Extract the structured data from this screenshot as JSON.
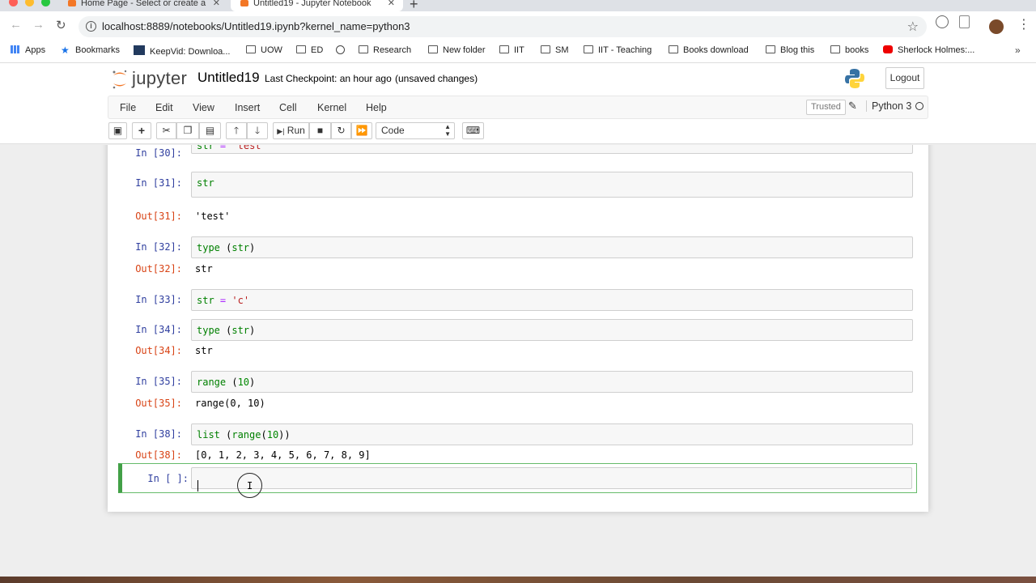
{
  "browser": {
    "tabs": [
      {
        "title": "Home Page - Select or create a",
        "active": false
      },
      {
        "title": "Untitled19 - Jupyter Notebook",
        "active": true
      }
    ],
    "url": "localhost:8889/notebooks/Untitled19.ipynb?kernel_name=python3",
    "bookmarks": [
      {
        "label": "Apps",
        "icon": "apps-grid-icon"
      },
      {
        "label": "Bookmarks",
        "icon": "star-icon"
      },
      {
        "label": "KeepVid: Downloa...",
        "icon": "keepvid-icon"
      },
      {
        "label": "UOW",
        "icon": "folder-icon"
      },
      {
        "label": "ED",
        "icon": "folder-icon"
      },
      {
        "label": "Research",
        "icon": "folder-icon"
      },
      {
        "label": "New folder",
        "icon": "folder-icon"
      },
      {
        "label": "IIT",
        "icon": "folder-icon"
      },
      {
        "label": "SM",
        "icon": "folder-icon"
      },
      {
        "label": "IIT - Teaching",
        "icon": "folder-icon"
      },
      {
        "label": "Books download",
        "icon": "folder-icon"
      },
      {
        "label": "Blog this",
        "icon": "folder-icon"
      },
      {
        "label": "books",
        "icon": "folder-icon"
      },
      {
        "label": "Sherlock Holmes:...",
        "icon": "youtube-icon"
      }
    ],
    "more": "»"
  },
  "jupyter": {
    "logo_text": "jupyter",
    "notebook_name": "Untitled19",
    "checkpoint": "Last Checkpoint: an hour ago",
    "unsaved": "(unsaved changes)",
    "logout": "Logout",
    "menu": [
      "File",
      "Edit",
      "View",
      "Insert",
      "Cell",
      "Kernel",
      "Help"
    ],
    "trusted": "Trusted",
    "kernel_name": "Python 3",
    "run_label": "Run",
    "cell_type": "Code"
  },
  "cells": [
    {
      "prompt": "In [30]:",
      "code": "str = \"test\""
    },
    {
      "prompt": "In [31]:",
      "code": "str",
      "out_prompt": "Out[31]:",
      "output": "'test'"
    },
    {
      "prompt": "In [32]:",
      "code": "type (str)",
      "out_prompt": "Out[32]:",
      "output": "str"
    },
    {
      "prompt": "In [33]:",
      "code": "str = 'c'"
    },
    {
      "prompt": "In [34]:",
      "code": "type (str)",
      "out_prompt": "Out[34]:",
      "output": "str"
    },
    {
      "prompt": "In [35]:",
      "code": "range (10)",
      "out_prompt": "Out[35]:",
      "output": "range(0, 10)"
    },
    {
      "prompt": "In [38]:",
      "code": "list (range(10))",
      "out_prompt": "Out[38]:",
      "output": "[0, 1, 2, 3, 4, 5, 6, 7, 8, 9]"
    },
    {
      "prompt": "In [ ]:",
      "code": ""
    }
  ],
  "colors": {
    "selected_cell_border": "#42a047",
    "in_prompt": "#303f9f",
    "out_prompt": "#d84315"
  }
}
